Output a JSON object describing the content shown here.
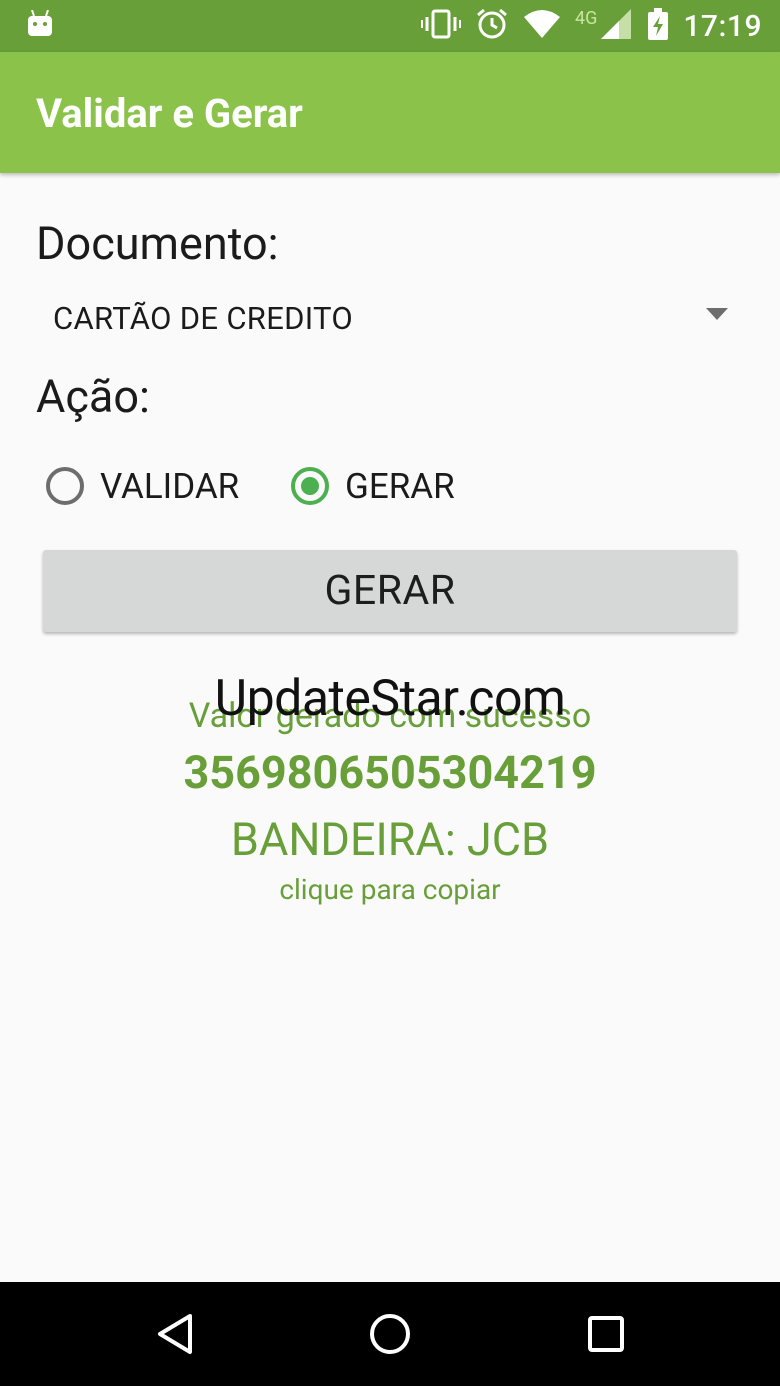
{
  "status_bar": {
    "time": "17:19",
    "network": "4G",
    "icons": [
      "android-icon",
      "vibrate-icon",
      "alarm-icon",
      "wifi-icon",
      "signal-icon",
      "battery-charging-icon"
    ]
  },
  "app_bar": {
    "title": "Validar e Gerar",
    "color": "#8bc34a"
  },
  "form": {
    "document_label": "Documento:",
    "document_value": "CARTÃO DE CREDITO",
    "action_label": "Ação:",
    "radios": [
      {
        "label": "VALIDAR",
        "checked": false
      },
      {
        "label": "GERAR",
        "checked": true
      }
    ],
    "button_label": "GERAR"
  },
  "result": {
    "message": "Valor gerado com sucesso",
    "number": "3569806505304219",
    "brand": "BANDEIRA: JCB",
    "copy_hint": "clique para copiar",
    "color": "#689f38"
  },
  "watermark": "UpdateStar.com",
  "nav_bar": {
    "icons": [
      "back-icon",
      "home-icon",
      "recents-icon"
    ]
  }
}
